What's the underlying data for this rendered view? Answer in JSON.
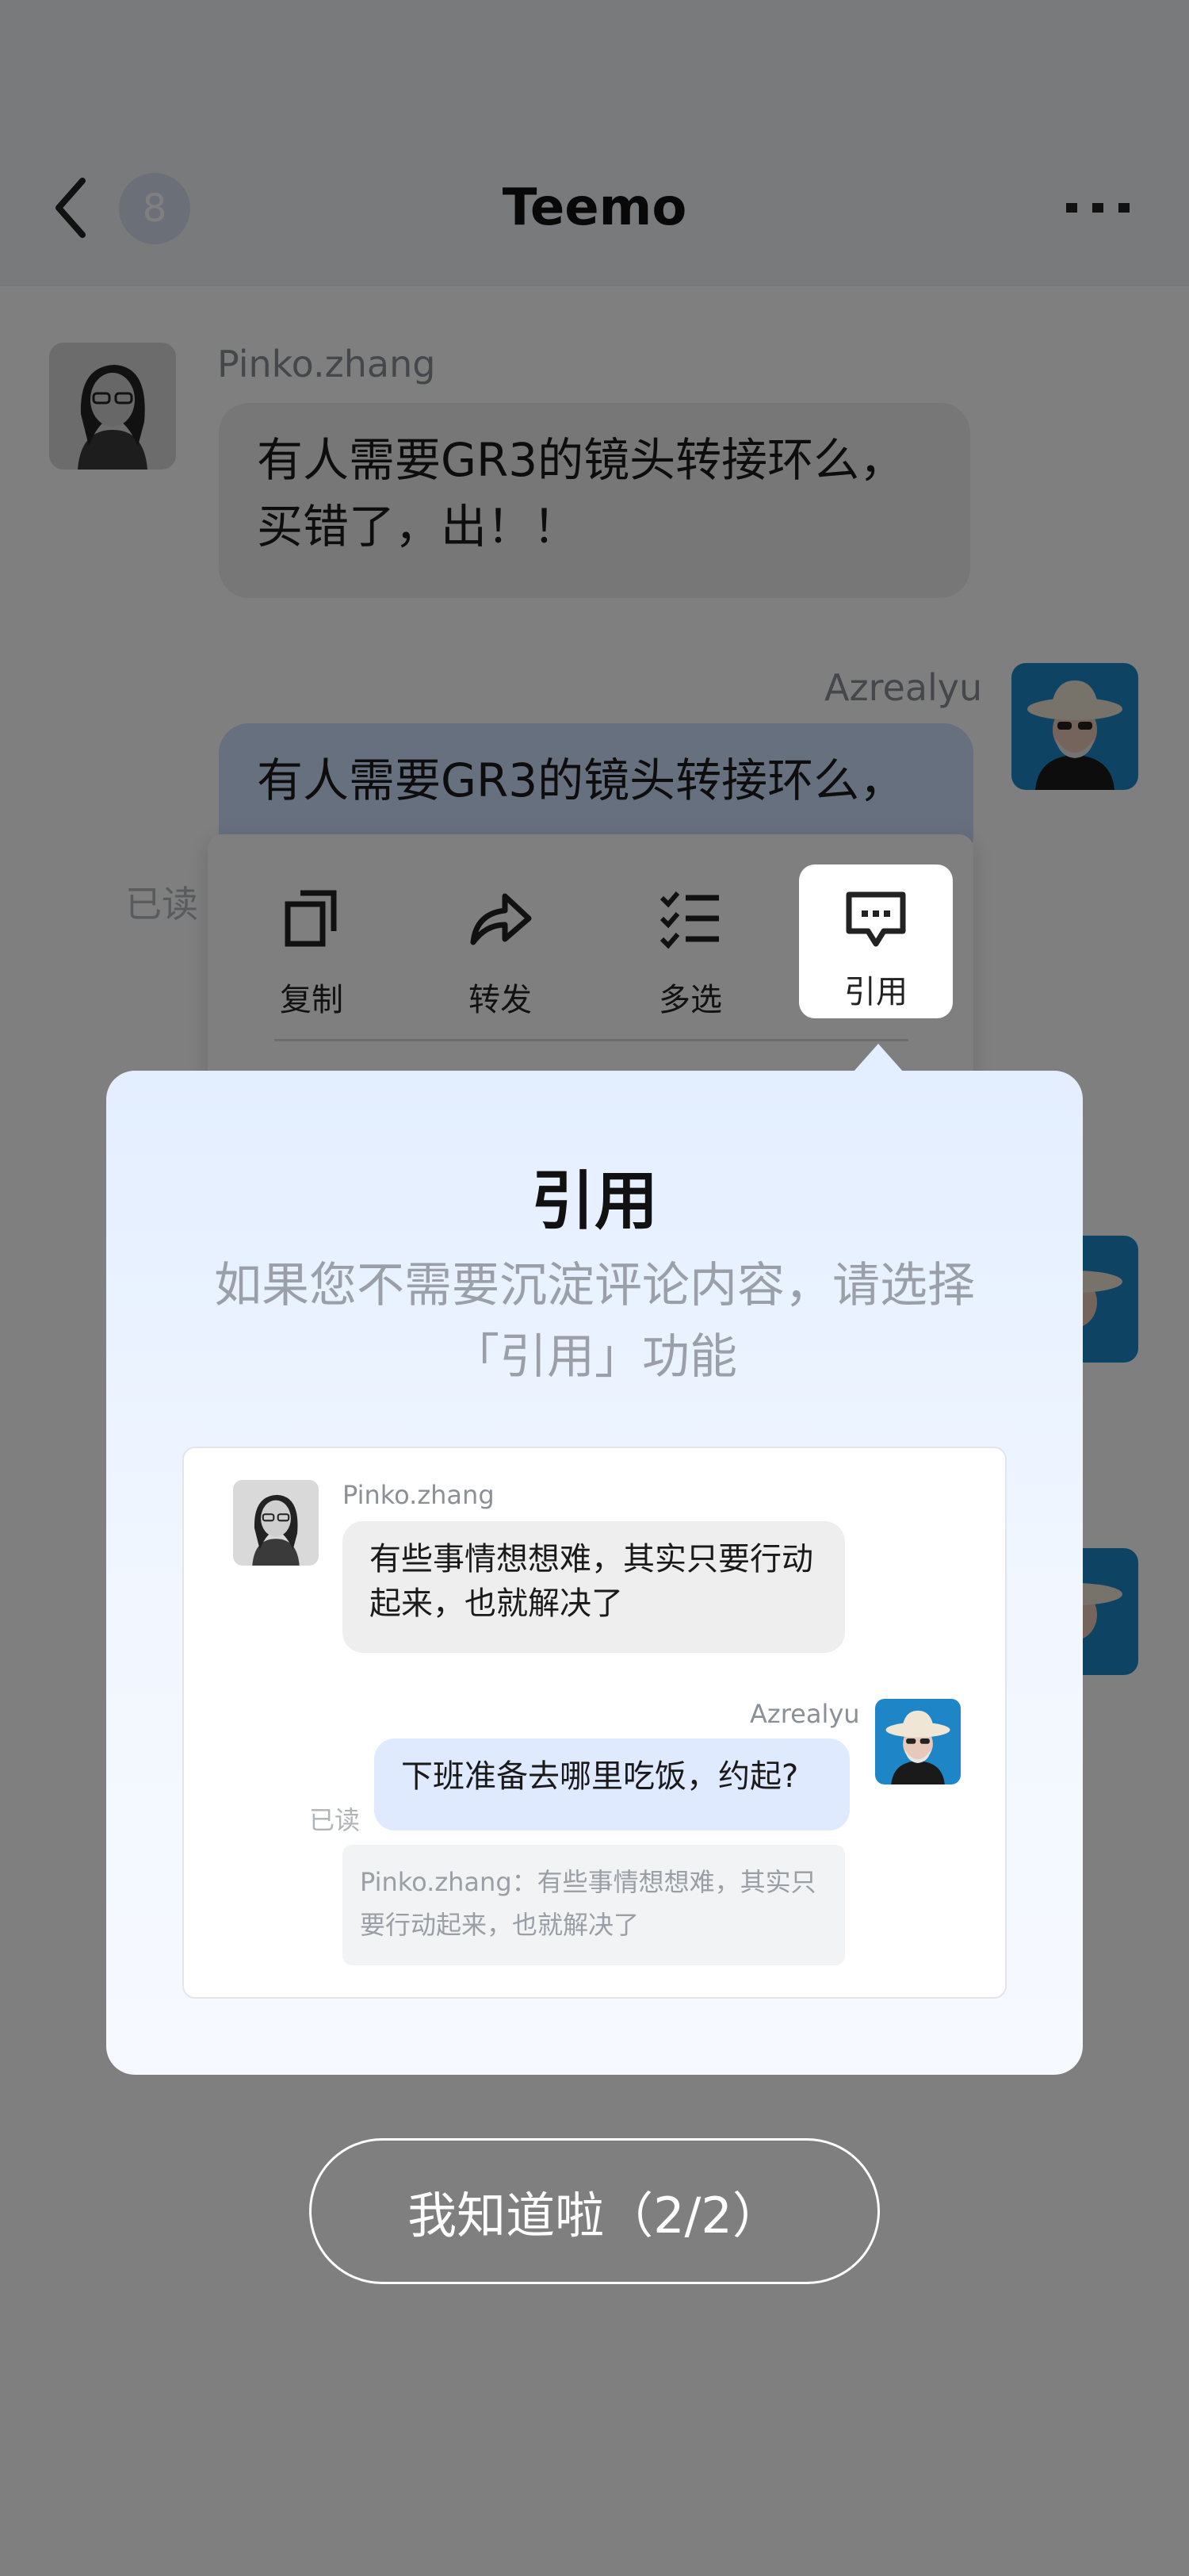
{
  "header": {
    "title": "Teemo",
    "unread_count": "8",
    "back_icon": "chevron-left-icon",
    "more_icon": "ellipsis-icon"
  },
  "chat": {
    "messages": [
      {
        "sender": "Pinko.zhang",
        "direction": "in",
        "text": "有人需要GR3的镜头转接环么，买错了，出！！"
      },
      {
        "sender": "Azrealyu",
        "direction": "out",
        "text": "有人需要GR3的镜头转接环么，",
        "status": "已读"
      }
    ]
  },
  "context_menu": {
    "items": [
      {
        "label": "复制",
        "icon": "copy-icon"
      },
      {
        "label": "转发",
        "icon": "forward-icon"
      },
      {
        "label": "多选",
        "icon": "multi-select-icon"
      },
      {
        "label": "引用",
        "icon": "quote-icon",
        "active": true
      }
    ]
  },
  "guide": {
    "title": "引用",
    "description": "如果您不需要沉淀评论内容，请选择「引用」功能",
    "example": {
      "in_name": "Pinko.zhang",
      "in_text": "有些事情想想难，其实只要行动起来，也就解决了",
      "out_name": "Azrealyu",
      "out_text": "下班准备去哪里吃饭，约起?",
      "read_status": "已读",
      "quote_text": "Pinko.zhang：有些事情想想难，其实只要行动起来，也就解决了"
    }
  },
  "confirm_button": {
    "label": "我知道啦（2/2）"
  },
  "colors": {
    "overlay": "rgba(0,0,0,0.5)",
    "bubble_in": "#eeeeef",
    "bubble_out": "#cfe0ff",
    "guide_gradient_top": "#e3eeff"
  }
}
